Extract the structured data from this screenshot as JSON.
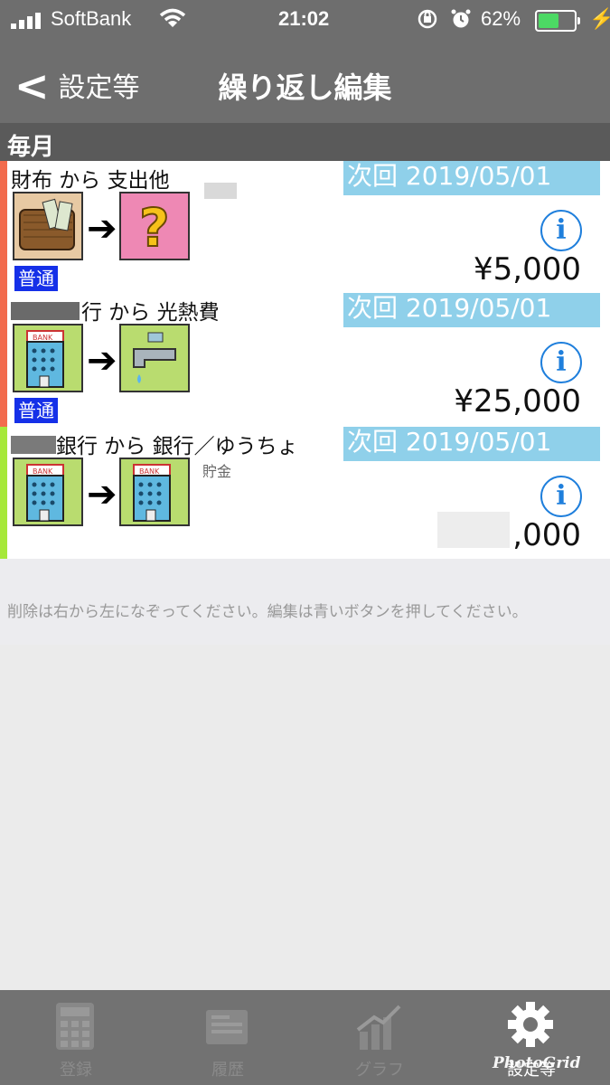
{
  "status": {
    "carrier": "SoftBank",
    "time": "21:02",
    "battery_percent": "62%",
    "battery_level": 0.62,
    "wifi_icon": "wifi-icon",
    "alarm_icon": "alarm-icon"
  },
  "nav": {
    "back_label": "設定等",
    "title": "繰り返し編集"
  },
  "section": {
    "label": "毎月"
  },
  "rows": [
    {
      "title": "財布 から 支出他",
      "next": "次回 2019/05/01",
      "amount": "¥5,000",
      "tag": "普通",
      "sub": "",
      "from_icon": "wallet-icon",
      "to_icon": "question-icon",
      "stripe_color": "#f26b4d"
    },
    {
      "title_prefix": "",
      "title": "行 から 光熱費",
      "next": "次回 2019/05/01",
      "amount": "¥25,000",
      "tag": "普通",
      "sub": "",
      "from_icon": "bank-icon",
      "to_icon": "faucet-icon",
      "stripe_color": "#f26b4d"
    },
    {
      "title": "銀行 から 銀行／ゆうちょ",
      "next": "次回 2019/05/01",
      "amount": ",000",
      "tag": "",
      "sub": "貯金",
      "from_icon": "bank-icon",
      "to_icon": "bank-icon",
      "stripe_color": "#a6e83a"
    }
  ],
  "note": "削除は右から左になぞってください。編集は青いボタンを押してください。",
  "tabs": [
    {
      "label": "登録",
      "icon": "calculator-icon",
      "active": false
    },
    {
      "label": "履歴",
      "icon": "history-icon",
      "active": false
    },
    {
      "label": "グラフ",
      "icon": "chart-icon",
      "active": false
    },
    {
      "label": "設定等",
      "icon": "gear-icon",
      "active": true
    }
  ],
  "watermark": "PhotoGrid",
  "colors": {
    "nav_bg": "#6e6e6e",
    "date_bg": "#8fd0ea",
    "info_blue": "#1f7fdc",
    "tag_blue": "#1530e8"
  }
}
